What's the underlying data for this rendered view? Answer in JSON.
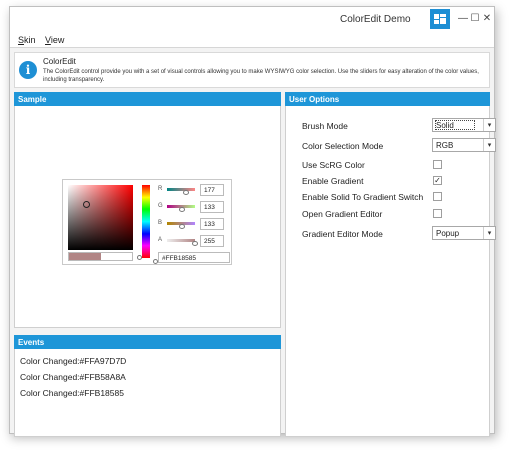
{
  "window": {
    "title": "ColorEdit Demo",
    "controls": {
      "minimize": "—",
      "maximize": "☐",
      "close": "✕"
    }
  },
  "menu": {
    "items": [
      {
        "first": "S",
        "rest": "kin"
      },
      {
        "first": "V",
        "rest": "iew"
      }
    ]
  },
  "info": {
    "icon": "i",
    "title": "ColorEdit",
    "description": "The ColorEdit control provide you with a set of visual controls allowing you to make WYSIWYG color selection. Use the sliders for easy alteration of the color values, including transparency."
  },
  "sample": {
    "header": "Sample",
    "color_editor": {
      "channels": [
        {
          "label": "R",
          "value": "177",
          "thumb_fraction": 0.69
        },
        {
          "label": "G",
          "value": "133",
          "thumb_fraction": 0.52
        },
        {
          "label": "B",
          "value": "133",
          "thumb_fraction": 0.52
        },
        {
          "label": "A",
          "value": "255",
          "thumb_fraction": 1.0
        }
      ],
      "hex": "#FFB18585",
      "current_color": "#b18585"
    }
  },
  "user_options": {
    "header": "User Options",
    "brush_mode": {
      "label": "Brush Mode",
      "value": "Solid"
    },
    "color_selection_mode": {
      "label": "Color Selection Mode",
      "value": "RGB"
    },
    "use_scrgb": {
      "label": "Use ScRG Color",
      "checked": false
    },
    "enable_gradient": {
      "label": "Enable Gradient",
      "checked": true,
      "mark": "✓"
    },
    "enable_solid_to_gradient": {
      "label": "Enable Solid To Gradient Switch",
      "checked": false
    },
    "open_gradient_editor": {
      "label": "Open Gradient Editor",
      "checked": false
    },
    "gradient_editor_mode": {
      "label": "Gradient Editor Mode",
      "value": "Popup"
    },
    "dropdown_arrow": "▾"
  },
  "events": {
    "header": "Events",
    "lines": [
      "Color Changed:#FFA97D7D",
      "Color Changed:#FFB58A8A",
      "Color Changed:#FFB18585"
    ]
  },
  "colors": {
    "accent": "#1e96d8",
    "window_bg": "#f3f3f3"
  }
}
